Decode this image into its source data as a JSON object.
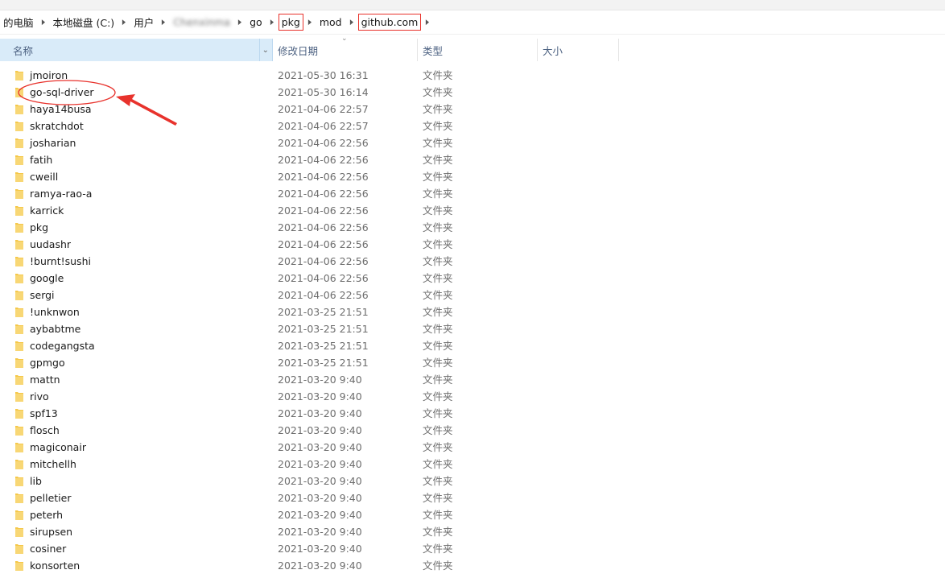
{
  "breadcrumb": [
    {
      "label": "的电脑",
      "boxed": false,
      "blurred": false
    },
    {
      "label": "本地磁盘 (C:)",
      "boxed": false,
      "blurred": false
    },
    {
      "label": "用户",
      "boxed": false,
      "blurred": false
    },
    {
      "label": "Chenxinma",
      "boxed": false,
      "blurred": true
    },
    {
      "label": "go",
      "boxed": false,
      "blurred": false
    },
    {
      "label": "pkg",
      "boxed": true,
      "blurred": false
    },
    {
      "label": "mod",
      "boxed": false,
      "blurred": false
    },
    {
      "label": "github.com",
      "boxed": true,
      "blurred": false
    }
  ],
  "columns": {
    "name": "名称",
    "date": "修改日期",
    "type": "类型",
    "size": "大小"
  },
  "colors": {
    "folder": "#f5c84a",
    "annotation": "#e8322c",
    "header_selected": "#d9ebf9"
  },
  "rows": [
    {
      "name": "jmoiron",
      "date": "2021-05-30 16:31",
      "type": "文件夹"
    },
    {
      "name": "go-sql-driver",
      "date": "2021-05-30 16:14",
      "type": "文件夹"
    },
    {
      "name": "haya14busa",
      "date": "2021-04-06 22:57",
      "type": "文件夹"
    },
    {
      "name": "skratchdot",
      "date": "2021-04-06 22:57",
      "type": "文件夹"
    },
    {
      "name": "josharian",
      "date": "2021-04-06 22:56",
      "type": "文件夹"
    },
    {
      "name": "fatih",
      "date": "2021-04-06 22:56",
      "type": "文件夹"
    },
    {
      "name": "cweill",
      "date": "2021-04-06 22:56",
      "type": "文件夹"
    },
    {
      "name": "ramya-rao-a",
      "date": "2021-04-06 22:56",
      "type": "文件夹"
    },
    {
      "name": "karrick",
      "date": "2021-04-06 22:56",
      "type": "文件夹"
    },
    {
      "name": "pkg",
      "date": "2021-04-06 22:56",
      "type": "文件夹"
    },
    {
      "name": "uudashr",
      "date": "2021-04-06 22:56",
      "type": "文件夹"
    },
    {
      "name": "!burnt!sushi",
      "date": "2021-04-06 22:56",
      "type": "文件夹"
    },
    {
      "name": "google",
      "date": "2021-04-06 22:56",
      "type": "文件夹"
    },
    {
      "name": "sergi",
      "date": "2021-04-06 22:56",
      "type": "文件夹"
    },
    {
      "name": "!unknwon",
      "date": "2021-03-25 21:51",
      "type": "文件夹"
    },
    {
      "name": "aybabtme",
      "date": "2021-03-25 21:51",
      "type": "文件夹"
    },
    {
      "name": "codegangsta",
      "date": "2021-03-25 21:51",
      "type": "文件夹"
    },
    {
      "name": "gpmgo",
      "date": "2021-03-25 21:51",
      "type": "文件夹"
    },
    {
      "name": "mattn",
      "date": "2021-03-20 9:40",
      "type": "文件夹"
    },
    {
      "name": "rivo",
      "date": "2021-03-20 9:40",
      "type": "文件夹"
    },
    {
      "name": "spf13",
      "date": "2021-03-20 9:40",
      "type": "文件夹"
    },
    {
      "name": "flosch",
      "date": "2021-03-20 9:40",
      "type": "文件夹"
    },
    {
      "name": "magiconair",
      "date": "2021-03-20 9:40",
      "type": "文件夹"
    },
    {
      "name": "mitchellh",
      "date": "2021-03-20 9:40",
      "type": "文件夹"
    },
    {
      "name": "lib",
      "date": "2021-03-20 9:40",
      "type": "文件夹"
    },
    {
      "name": "pelletier",
      "date": "2021-03-20 9:40",
      "type": "文件夹"
    },
    {
      "name": "peterh",
      "date": "2021-03-20 9:40",
      "type": "文件夹"
    },
    {
      "name": "sirupsen",
      "date": "2021-03-20 9:40",
      "type": "文件夹"
    },
    {
      "name": "cosiner",
      "date": "2021-03-20 9:40",
      "type": "文件夹"
    },
    {
      "name": "konsorten",
      "date": "2021-03-20 9:40",
      "type": "文件夹"
    }
  ]
}
